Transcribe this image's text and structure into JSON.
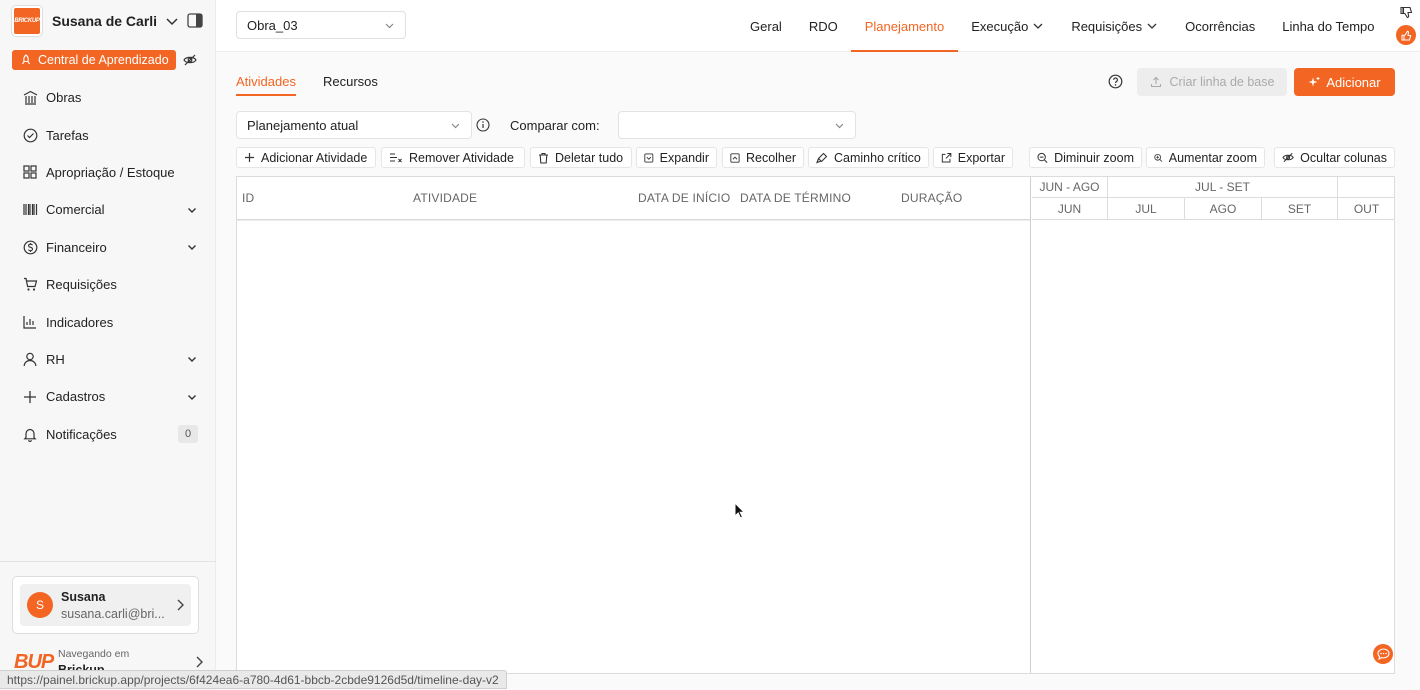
{
  "sidebar": {
    "brand_logo_text": "BRICKUP",
    "account_name": "Susana de Carli",
    "learning_center": "Central de Aprendizado",
    "items": [
      {
        "label": "Obras",
        "icon": "building-icon"
      },
      {
        "label": "Tarefas",
        "icon": "check-circle-icon"
      },
      {
        "label": "Apropriação / Estoque",
        "icon": "grid-icon"
      },
      {
        "label": "Comercial",
        "icon": "barcode-icon",
        "expandable": true
      },
      {
        "label": "Financeiro",
        "icon": "dollar-circle-icon",
        "expandable": true
      },
      {
        "label": "Requisições",
        "icon": "cart-icon"
      },
      {
        "label": "Indicadores",
        "icon": "bar-chart-icon"
      },
      {
        "label": "RH",
        "icon": "user-icon",
        "expandable": true
      },
      {
        "label": "Cadastros",
        "icon": "plus-icon",
        "expandable": true
      },
      {
        "label": "Notificações",
        "icon": "bell-icon",
        "badge": "0"
      }
    ],
    "user": {
      "initial": "S",
      "name": "Susana",
      "email": "susana.carli@bri..."
    },
    "browsing": {
      "caption": "Navegando em",
      "company": "Brickup",
      "logo_text": "BUP"
    }
  },
  "header": {
    "project_select": "Obra_03",
    "nav": [
      {
        "label": "Geral"
      },
      {
        "label": "RDO"
      },
      {
        "label": "Planejamento",
        "active": true
      },
      {
        "label": "Execução",
        "dropdown": true
      },
      {
        "label": "Requisições",
        "dropdown": true
      },
      {
        "label": "Ocorrências"
      },
      {
        "label": "Linha do Tempo"
      }
    ]
  },
  "main": {
    "tabs": [
      {
        "label": "Atividades",
        "active": true
      },
      {
        "label": "Recursos"
      }
    ],
    "baseline_button": "Criar linha de base",
    "add_button": "Adicionar",
    "plan_select": "Planejamento atual",
    "compare_label": "Comparar com:",
    "compare_value": "",
    "toolbar": {
      "add_activity": "Adicionar Atividade",
      "remove_activity": "Remover Atividade",
      "delete_all": "Deletar tudo",
      "expand": "Expandir",
      "collapse": "Recolher",
      "critical_path": "Caminho crítico",
      "export": "Exportar",
      "zoom_out": "Diminuir zoom",
      "zoom_in": "Aumentar zoom",
      "hide_columns": "Ocultar colunas"
    },
    "columns": {
      "id": "ID",
      "activity": "ATIVIDADE",
      "start": "DATA DE INÍCIO",
      "end": "DATA DE TÉRMINO",
      "duration": "DURAÇÃO"
    },
    "gantt": {
      "groups": [
        "JUN - AGO",
        "JUL - SET",
        ""
      ],
      "months": [
        "JUN",
        "JUL",
        "AGO",
        "SET",
        "OUT"
      ]
    }
  },
  "status_url": "https://painel.brickup.app/projects/6f424ea6-a780-4d61-bbcb-2cbde9126d5d/timeline-day-v2",
  "colors": {
    "accent": "#f26522"
  }
}
